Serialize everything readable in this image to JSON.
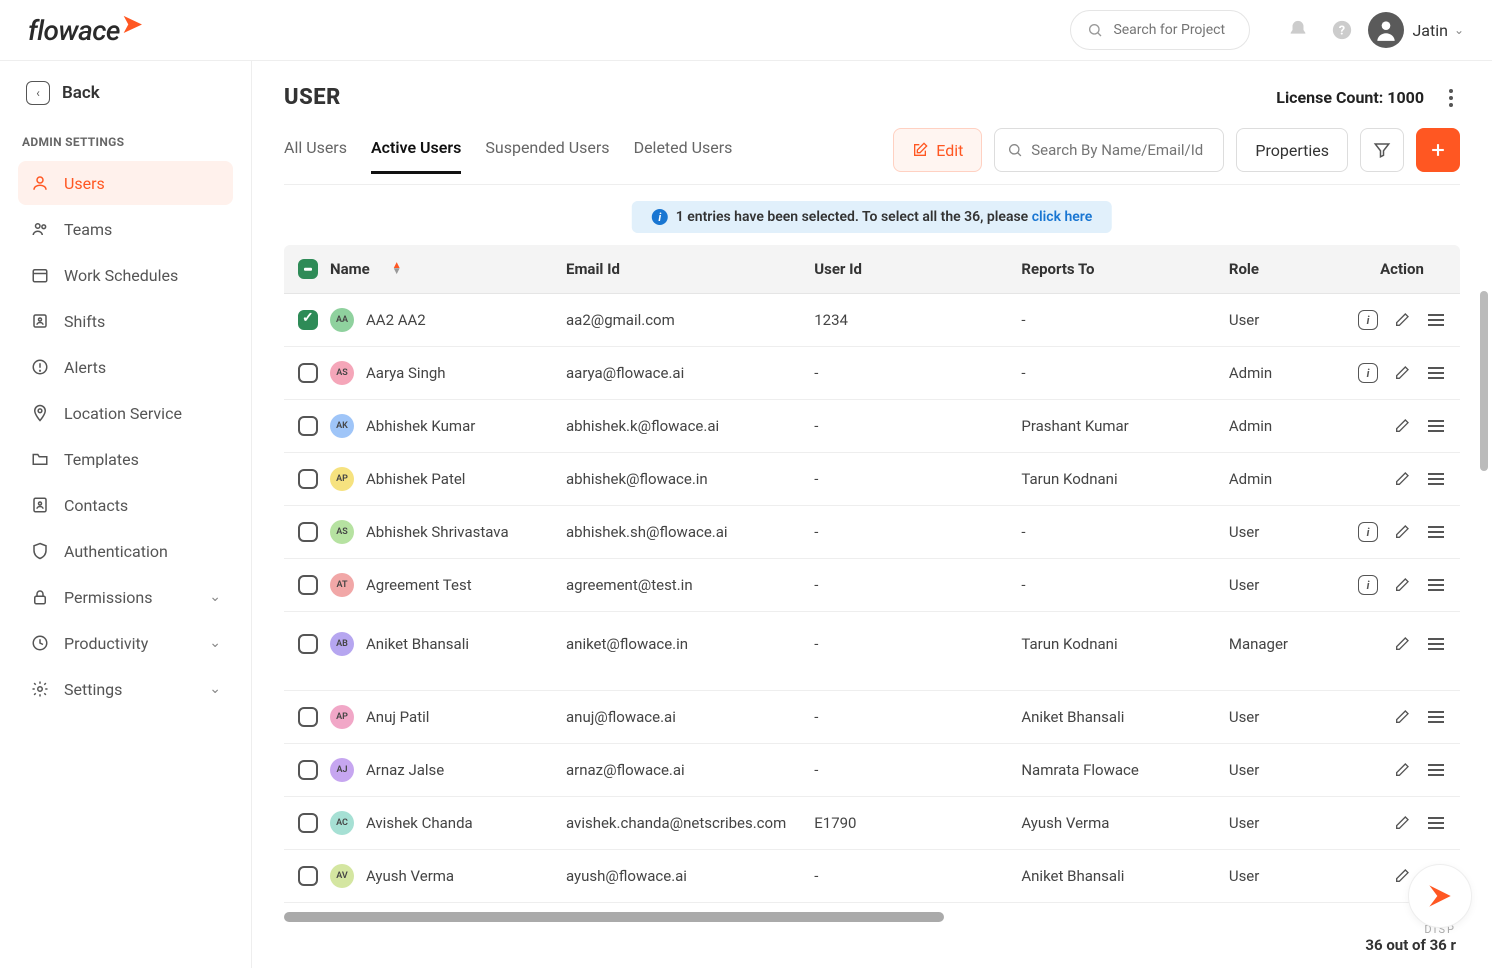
{
  "brand": "flowace",
  "header": {
    "search_placeholder": "Search for Project",
    "user_name": "Jatin"
  },
  "sidebar": {
    "back": "Back",
    "section_label": "ADMIN SETTINGS",
    "items": [
      {
        "label": "Users",
        "icon": "user",
        "active": true
      },
      {
        "label": "Teams",
        "icon": "users"
      },
      {
        "label": "Work Schedules",
        "icon": "calendar"
      },
      {
        "label": "Shifts",
        "icon": "clock-user"
      },
      {
        "label": "Alerts",
        "icon": "alert"
      },
      {
        "label": "Location Service",
        "icon": "location"
      },
      {
        "label": "Templates",
        "icon": "folder"
      },
      {
        "label": "Contacts",
        "icon": "contact"
      },
      {
        "label": "Authentication",
        "icon": "shield"
      },
      {
        "label": "Permissions",
        "icon": "lock",
        "expandable": true
      },
      {
        "label": "Productivity",
        "icon": "chart",
        "expandable": true
      },
      {
        "label": "Settings",
        "icon": "gear",
        "expandable": true
      }
    ]
  },
  "page": {
    "title": "USER",
    "license_label": "License Count: 1000"
  },
  "tabs": [
    {
      "label": "All Users"
    },
    {
      "label": "Active Users",
      "active": true
    },
    {
      "label": "Suspended Users"
    },
    {
      "label": "Deleted Users"
    }
  ],
  "toolbar": {
    "edit": "Edit",
    "search_placeholder": "Search By Name/Email/Id",
    "properties": "Properties"
  },
  "banner": {
    "text_a": "1 entries have been selected. To select all the 36, please ",
    "link": "click here"
  },
  "columns": {
    "name": "Name",
    "email": "Email Id",
    "userid": "User Id",
    "reports": "Reports To",
    "role": "Role",
    "action": "Action"
  },
  "rows": [
    {
      "checked": true,
      "initials": "AA",
      "color": "#8fd19e",
      "name": "AA2 AA2",
      "email": "aa2@gmail.com",
      "userid": "1234",
      "reports": "-",
      "role": "User",
      "info": true
    },
    {
      "initials": "AS",
      "color": "#f5a6b9",
      "name": "Aarya Singh",
      "email": "aarya@flowace.ai",
      "userid": "-",
      "reports": "-",
      "role": "Admin",
      "info": true
    },
    {
      "initials": "AK",
      "color": "#9fc5f8",
      "name": "Abhishek Kumar",
      "email": "abhishek.k@flowace.ai",
      "userid": "-",
      "reports": "Prashant Kumar",
      "role": "Admin"
    },
    {
      "initials": "AP",
      "color": "#f6e27f",
      "name": "Abhishek Patel",
      "email": "abhishek@flowace.in",
      "userid": "-",
      "reports": "Tarun Kodnani",
      "role": "Admin"
    },
    {
      "initials": "AS",
      "color": "#b6e2a1",
      "name": "Abhishek Shrivastava",
      "email": "abhishek.sh@flowace.ai",
      "userid": "-",
      "reports": "-",
      "role": "User",
      "info": true
    },
    {
      "initials": "AT",
      "color": "#f1a7a7",
      "name": "Agreement Test",
      "email": "agreement@test.in",
      "userid": "-",
      "reports": "-",
      "role": "User",
      "info": true
    },
    {
      "initials": "AB",
      "color": "#b6a6f0",
      "name": "Aniket Bhansali",
      "email": "aniket@flowace.in",
      "userid": "-",
      "reports": "Tarun Kodnani",
      "role": "Manager",
      "tall": true
    },
    {
      "initials": "AP",
      "color": "#f1a7c7",
      "name": "Anuj Patil",
      "email": "anuj@flowace.ai",
      "userid": "-",
      "reports": "Aniket Bhansali",
      "role": "User"
    },
    {
      "initials": "AJ",
      "color": "#c6a6f0",
      "name": "Arnaz Jalse",
      "email": "arnaz@flowace.ai",
      "userid": "-",
      "reports": "Namrata Flowace",
      "role": "User"
    },
    {
      "initials": "AC",
      "color": "#a6e0d4",
      "name": "Avishek Chanda",
      "email": "avishek.chanda@netscribes.com",
      "userid": "E1790",
      "reports": "Ayush Verma",
      "role": "User"
    },
    {
      "initials": "AV",
      "color": "#d4e6a1",
      "name": "Ayush Verma",
      "email": "ayush@flowace.ai",
      "userid": "-",
      "reports": "Aniket Bhansali",
      "role": "User"
    }
  ],
  "footer": {
    "label": "DISP",
    "count": "36 out of 36 r"
  }
}
